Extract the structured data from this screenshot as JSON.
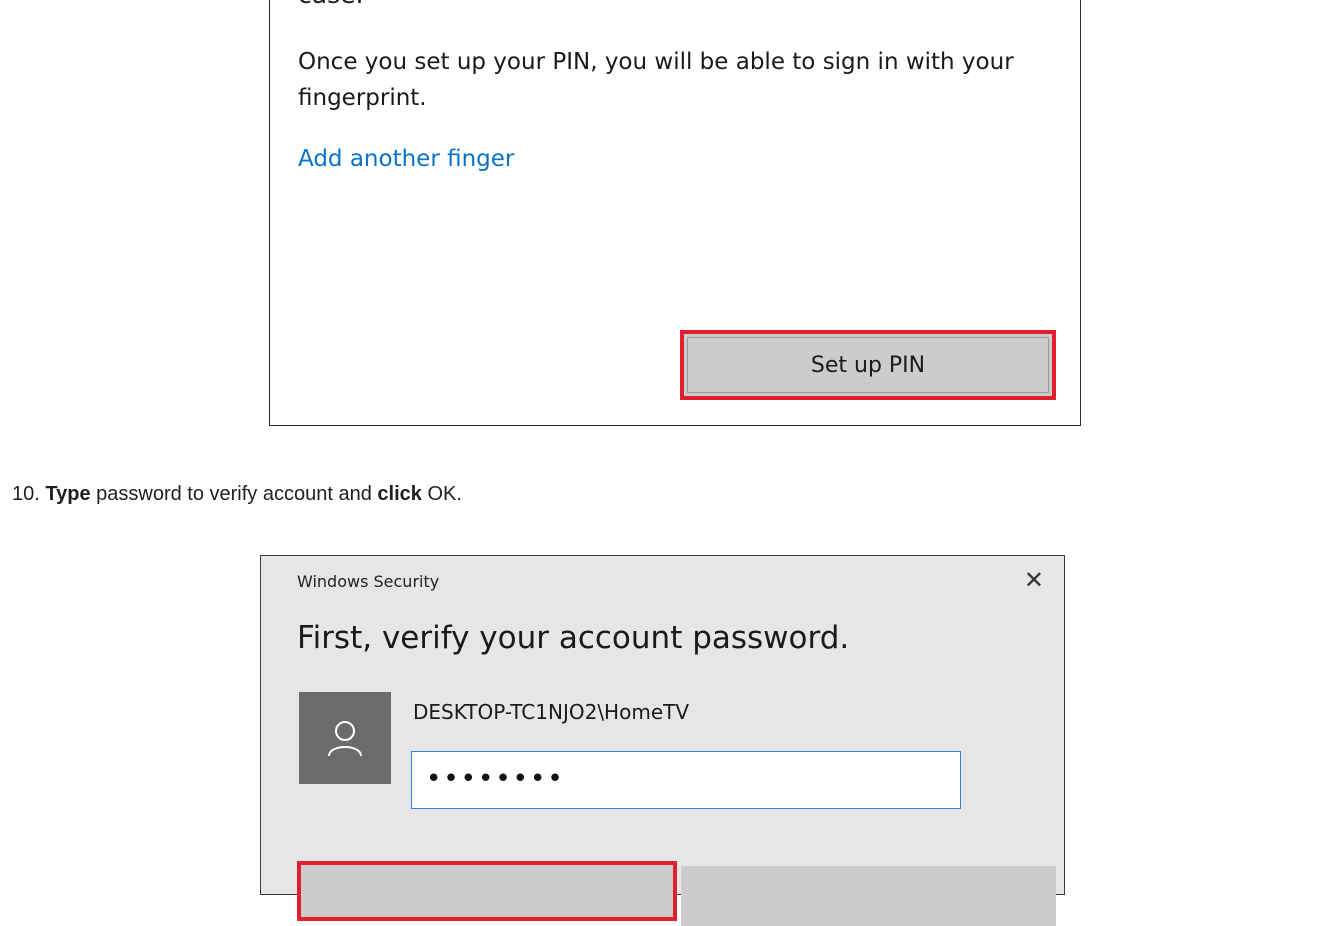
{
  "panel1": {
    "cut_text": "case.",
    "paragraph": "Once you set up your PIN, you will be able to sign in with your fingerprint.",
    "link": "Add another finger",
    "button": "Set up PIN"
  },
  "step": {
    "number": "10.",
    "verb1": "Type",
    "mid": " password to verify account and ",
    "verb2": "click",
    "end": " OK."
  },
  "dialog": {
    "title": "Windows Security",
    "close_glyph": "✕",
    "heading": "First, verify your account password.",
    "account": "DESKTOP-TC1NJO2\\HomeTV",
    "password_mask": "••••••••"
  },
  "colors": {
    "highlight": "#e0202e",
    "link": "#0a73c8",
    "input_border": "#2f86d6"
  }
}
